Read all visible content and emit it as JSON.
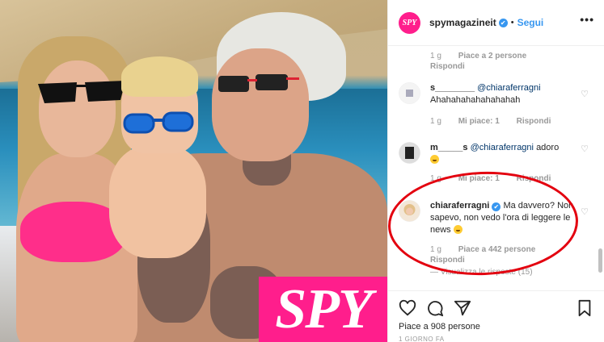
{
  "header": {
    "username": "spymagazineit",
    "verified_glyph": "✔",
    "separator": "•",
    "follow_label": "Segui",
    "more_label": "•••",
    "avatar_text": "SPY"
  },
  "photo": {
    "watermark": "SPY"
  },
  "comments": [
    {
      "meta_time": "1 g",
      "meta_likes": "Piace a 2 persone",
      "reply_label": "Rispondi"
    },
    {
      "username": "s________",
      "mention": "@chiaraferragni",
      "text": "Ahahahahahahahahah",
      "meta_time": "1 g",
      "meta_likes": "Mi piace: 1",
      "reply_label": "Rispondi"
    },
    {
      "username": "m_____s",
      "mention": "@chiaraferragni",
      "text": "adoro",
      "meta_time": "1 g",
      "meta_likes": "Mi piace: 1",
      "reply_label": "Rispondi"
    },
    {
      "username": "chiaraferragni",
      "text": "Ma davvero? Non sapevo, non vedo l'ora di leggere le news",
      "meta_time": "1 g",
      "meta_likes": "Piace a 442 persone",
      "reply_label": "Rispondi",
      "view_replies": "— Visualizza le risposte (15)"
    }
  ],
  "actions": {
    "likes_text": "Piace a 908 persone",
    "date_text": "1 GIORNO FA"
  },
  "colors": {
    "brand_pink": "#ff1e8c",
    "link_blue": "#3897f0",
    "annotation_red": "#e3000f"
  }
}
